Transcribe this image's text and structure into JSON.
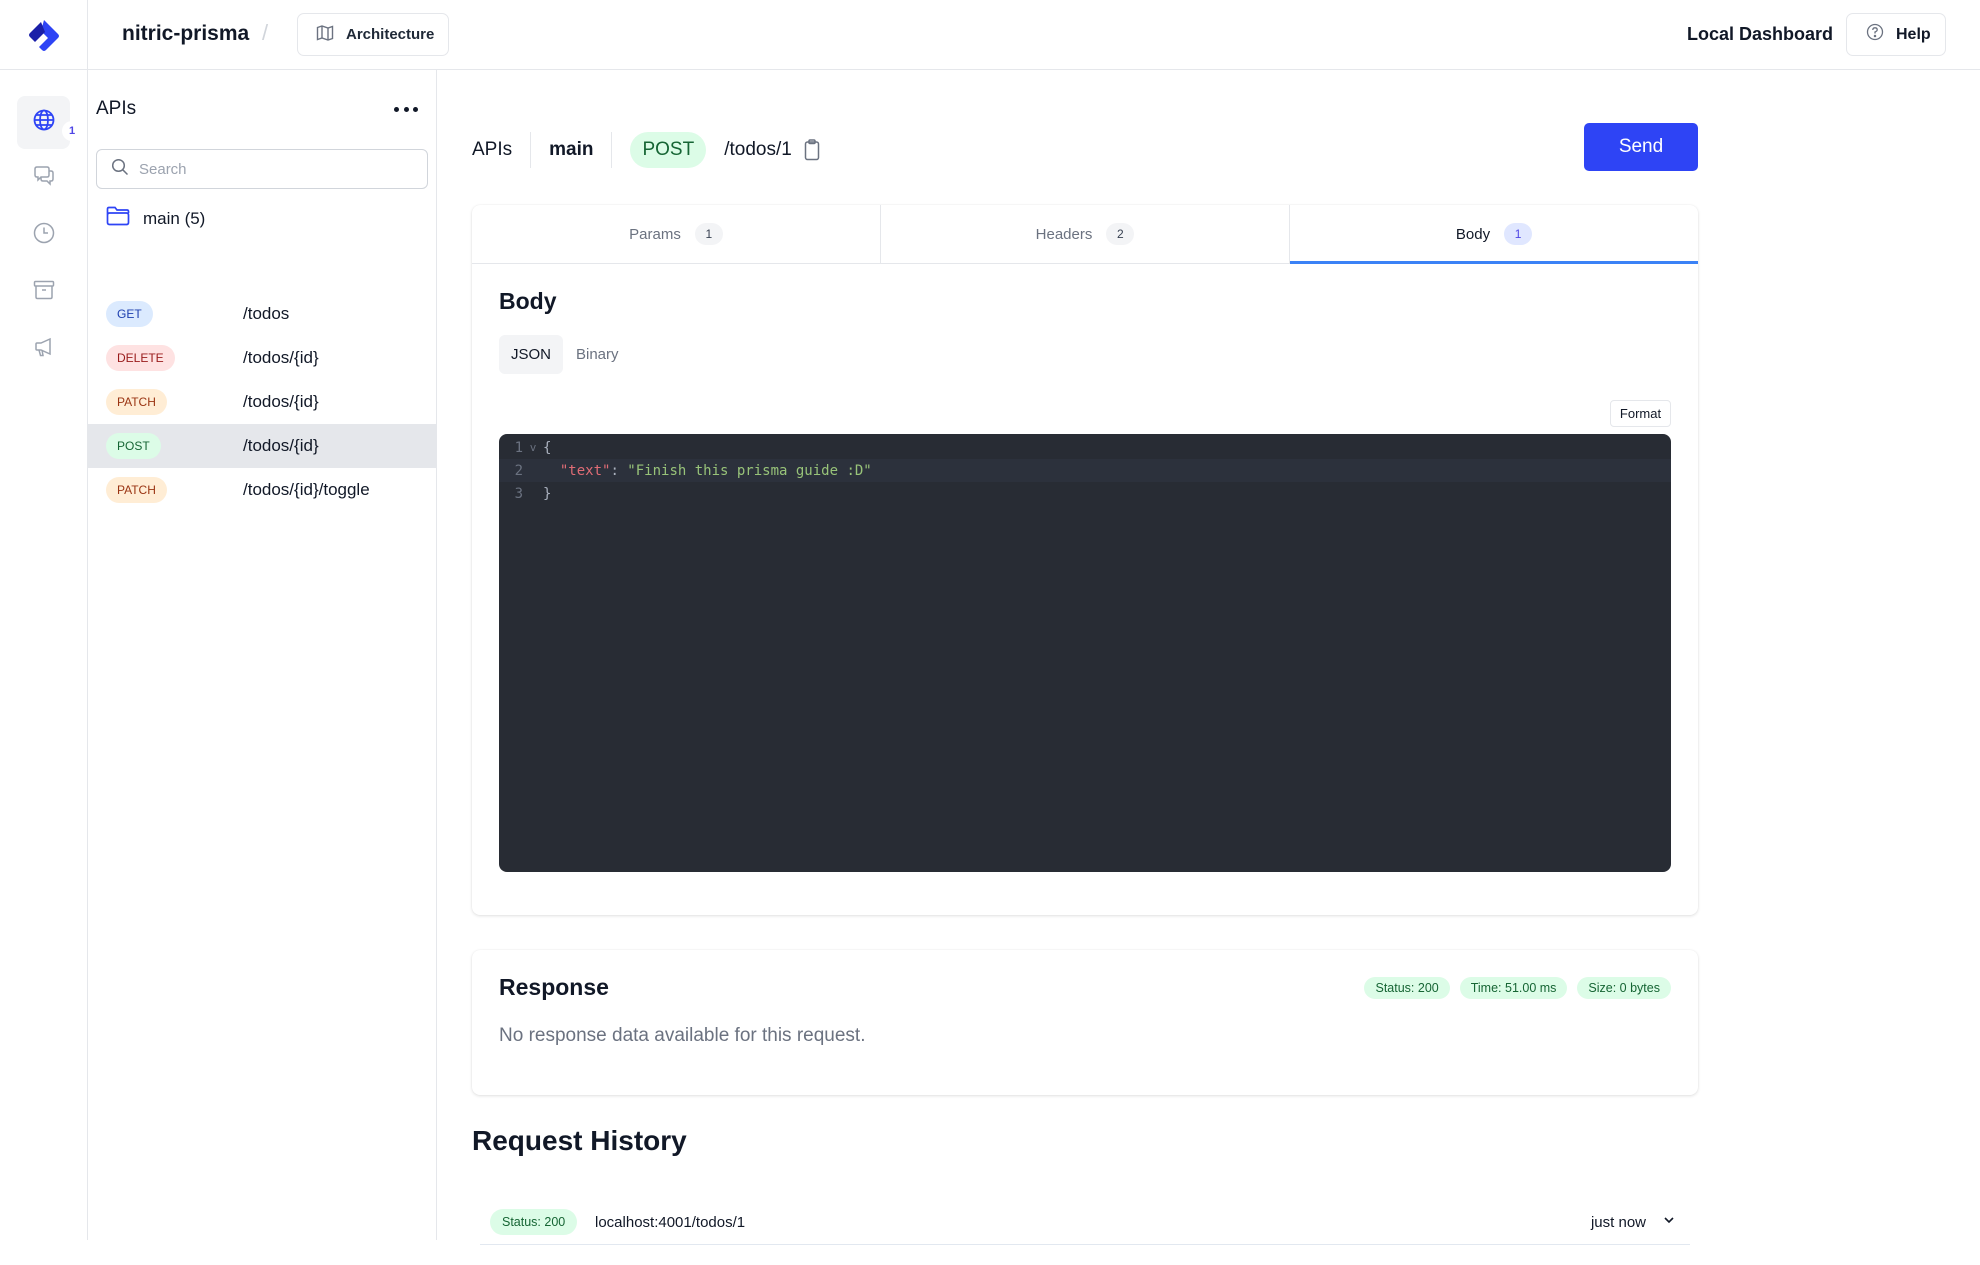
{
  "header": {
    "project_name": "nitric-prisma",
    "separator": "/",
    "architecture_label": "Architecture",
    "local_dashboard_label": "Local Dashboard",
    "help_label": "Help",
    "brand_color": "#2e44f5"
  },
  "rail": {
    "items": [
      {
        "name": "apis",
        "icon": "globe-icon",
        "active": true,
        "badge": "1"
      },
      {
        "name": "websockets",
        "icon": "chat-bubbles-icon",
        "active": false
      },
      {
        "name": "schedules",
        "icon": "clock-icon",
        "active": false
      },
      {
        "name": "storage",
        "icon": "archive-box-icon",
        "active": false
      },
      {
        "name": "topics",
        "icon": "megaphone-icon",
        "active": false
      }
    ]
  },
  "sidebar": {
    "title": "APIs",
    "more_icon": "ellipsis-icon",
    "search_placeholder": "Search",
    "search_value": "",
    "folder": {
      "label": "main (5)",
      "icon": "folder-icon"
    },
    "routes": [
      {
        "method": "GET",
        "path": "/todos",
        "selected": false
      },
      {
        "method": "DELETE",
        "path": "/todos/{id}",
        "selected": false
      },
      {
        "method": "PATCH",
        "path": "/todos/{id}",
        "selected": false
      },
      {
        "method": "POST",
        "path": "/todos/{id}",
        "selected": true
      },
      {
        "method": "PATCH",
        "path": "/todos/{id}/toggle",
        "selected": false
      }
    ]
  },
  "request": {
    "breadcrumb_api": "APIs",
    "breadcrumb_service": "main",
    "method": "POST",
    "path": "/todos/1",
    "send_label": "Send",
    "tabs": [
      {
        "label": "Params",
        "count": "1",
        "active": false
      },
      {
        "label": "Headers",
        "count": "2",
        "active": false
      },
      {
        "label": "Body",
        "count": "1",
        "active": true
      }
    ],
    "body": {
      "title": "Body",
      "types": [
        {
          "label": "JSON",
          "active": true
        },
        {
          "label": "Binary",
          "active": false
        }
      ],
      "format_label": "Format",
      "code_lines": [
        {
          "number": "1",
          "fold": "v",
          "parts": [
            {
              "t": "{",
              "c": "punc"
            }
          ]
        },
        {
          "number": "2",
          "fold": "",
          "parts": [
            {
              "t": "  ",
              "c": "punc"
            },
            {
              "t": "\"text\"",
              "c": "key"
            },
            {
              "t": ": ",
              "c": "punc"
            },
            {
              "t": "\"Finish this prisma guide :D\"",
              "c": "str"
            }
          ]
        },
        {
          "number": "3",
          "fold": "",
          "parts": [
            {
              "t": "}",
              "c": "punc"
            }
          ]
        }
      ]
    }
  },
  "response": {
    "title": "Response",
    "badges": [
      "Status: 200",
      "Time: 51.00 ms",
      "Size: 0 bytes"
    ],
    "empty_message": "No response data available for this request."
  },
  "history": {
    "title": "Request History",
    "rows": [
      {
        "status": "Status: 200",
        "url": "localhost:4001/todos/1",
        "time": "just now"
      }
    ]
  }
}
